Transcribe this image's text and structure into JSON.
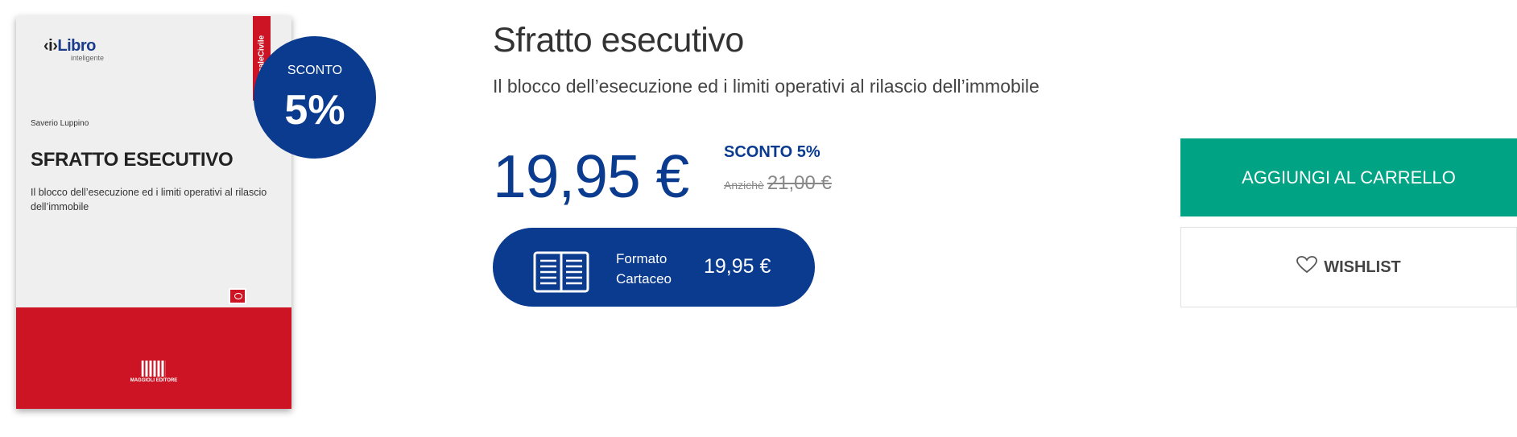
{
  "cover": {
    "logo_main": "Libro",
    "logo_bracket": "‹i›",
    "logo_sub": "inteligente",
    "side_label": "LegaleCivile",
    "author": "Saverio Luppino",
    "title": "SFRATTO ESECUTIVO",
    "subtitle": "Il blocco dell’esecuzione ed i limiti operativi al rilascio dell’immobile",
    "publisher": "MAGGIOLI EDITORE"
  },
  "discount_badge": {
    "label": "SCONTO",
    "value": "5%"
  },
  "product": {
    "title": "Sfratto esecutivo",
    "subtitle": "Il blocco dell’esecuzione ed i limiti operativi al rilascio dell’immobile",
    "price": "19,95 €",
    "discount_label": "SCONTO 5%",
    "old_prefix": "Anzichè",
    "old_price": "21,00 €"
  },
  "format": {
    "line1": "Formato",
    "line2": "Cartaceo",
    "price": "19,95 €",
    "icon": "book-icon"
  },
  "buttons": {
    "cart": "AGGIUNGI AL CARRELLO",
    "wishlist": "WISHLIST",
    "wishlist_icon": "heart-icon"
  },
  "colors": {
    "brand_blue": "#0a3b8f",
    "cart_green": "#00a384",
    "cover_red": "#cc1424"
  }
}
